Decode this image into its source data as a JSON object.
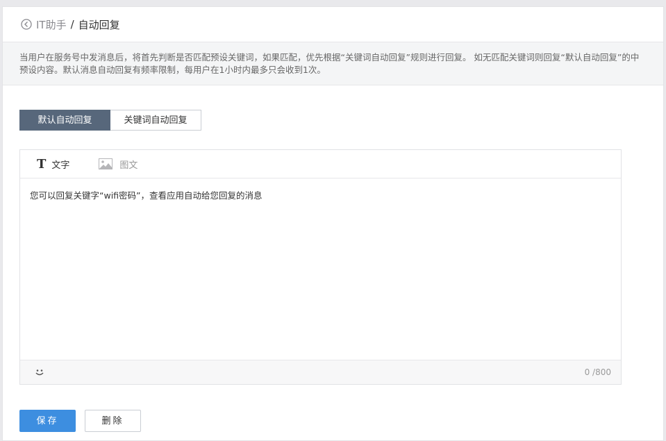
{
  "breadcrumb": {
    "parent": "IT助手",
    "separator": "/",
    "current": "自动回复"
  },
  "notice": {
    "text": "当用户在服务号中发消息后，将首先判断是否匹配预设关键词，如果匹配，优先根据“关键词自动回复”规则进行回复。 如无匹配关键词则回复“默认自动回复”的中预设内容。默认消息自动回复有频率限制，每用户在1小时内最多只会收到1次。"
  },
  "tabs": [
    {
      "label": "默认自动回复",
      "active": true
    },
    {
      "label": "关键词自动回复",
      "active": false
    }
  ],
  "editor": {
    "type_tabs": {
      "text_label": "文字",
      "image_label": "图文"
    },
    "content": "您可以回复关键字“wifi密码”，查看应用自动给您回复的消息",
    "counter": "0 /800"
  },
  "actions": {
    "save_label": "保存",
    "delete_label": "删除"
  },
  "colors": {
    "active_tab": "#57677b",
    "primary_button": "#3d8ee0"
  },
  "icons": {
    "back": "back-circle-icon",
    "text": "text-t-icon",
    "image": "image-icon",
    "emoji": "smile-icon"
  }
}
